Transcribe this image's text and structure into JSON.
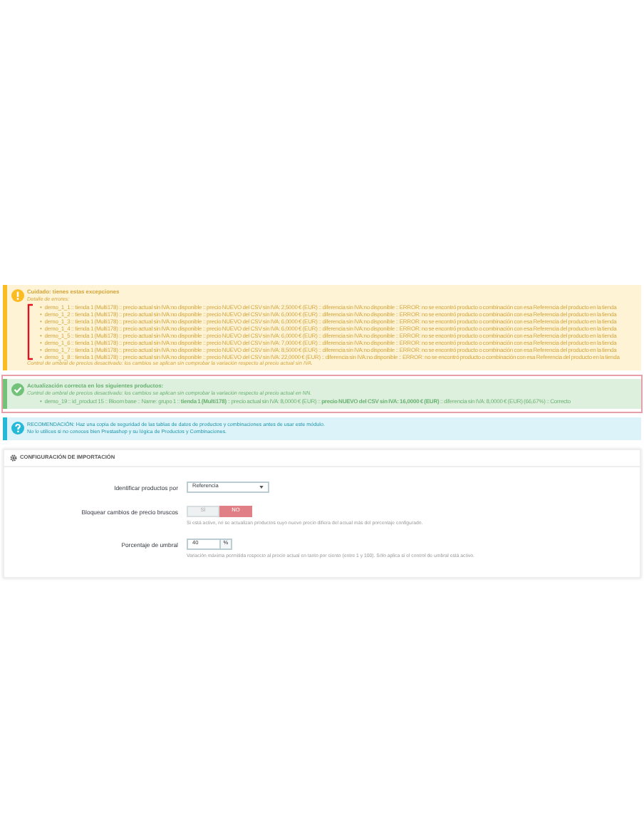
{
  "warning": {
    "title": "Cuidado: tienes estas excepciones",
    "subtitle": "Detalle de errores:",
    "bullet": "•",
    "items": [
      "demo_1_1 :: tienda 1 (Multi178) :: precio actual sin IVA:no disponible :: precio NUEVO del CSV sin IVA: 2,5000 € (EUR) :: diferencia sin IVA:no disponible :: ERROR: no se encontró producto o combinación con esa Referencia del producto en la tienda",
      "demo_1_2 :: tienda 1 (Multi178) :: precio actual sin IVA:no disponible :: precio NUEVO del CSV sin IVA: 6,0000 € (EUR) :: diferencia sin IVA:no disponible :: ERROR: no se encontró producto o combinación con esa Referencia del producto en la tienda",
      "demo_1_3 :: tienda 1 (Multi178) :: precio actual sin IVA:no disponible :: precio NUEVO del CSV sin IVA: 6,0000 € (EUR) :: diferencia sin IVA:no disponible :: ERROR: no se encontró producto o combinación con esa Referencia del producto en la tienda",
      "demo_1_4 :: tienda 1 (Multi178) :: precio actual sin IVA:no disponible :: precio NUEVO del CSV sin IVA: 6,0000 € (EUR) :: diferencia sin IVA:no disponible :: ERROR: no se encontró producto o combinación con esa Referencia del producto en la tienda",
      "demo_1_5 :: tienda 1 (Multi178) :: precio actual sin IVA:no disponible :: precio NUEVO del CSV sin IVA: 6,0000 € (EUR) :: diferencia sin IVA:no disponible :: ERROR: no se encontró producto o combinación con esa Referencia del producto en la tienda",
      "demo_1_6 :: tienda 1 (Multi178) :: precio actual sin IVA:no disponible :: precio NUEVO del CSV sin IVA: 7,0000 € (EUR) :: diferencia sin IVA:no disponible :: ERROR: no se encontró producto o combinación con esa Referencia del producto en la tienda",
      "demo_1_7 :: tienda 1 (Multi178) :: precio actual sin IVA:no disponible :: precio NUEVO del CSV sin IVA: 8,5000 € (EUR) :: diferencia sin IVA:no disponible :: ERROR: no se encontró producto o combinación con esa Referencia del producto en la tienda",
      "demo_1_8 :: tienda 1 (Multi178) :: precio actual sin IVA:no disponible :: precio NUEVO del CSV sin IVA: 22,0000 € (EUR) :: diferencia sin IVA:no disponible :: ERROR: no se encontró producto o combinación con esa Referencia del producto en la tienda"
    ],
    "footer": "Control de umbral de precios desactivado: los cambios se aplican sin comprobar la variación respecto al precio actual sin IVA."
  },
  "success": {
    "title": "Actualización correcta en los siguientes productos:",
    "bullet": "•",
    "subtitle": "Control de umbral de precios desactivado: los cambios se aplican sin comprobar la variación respecto al precio actual en NN.",
    "items": [
      "demo_19 :: id_product 15 :: Bloom base :: Name: grupo 1 :: **tienda 1 (Multi178)** :: precio actual sin IVA: 8,0000 € (EUR) :: **precio NUEVO del CSV sin IVA: 16,0000 € (EUR)** :: diferencia sin IVA: 8,0000 € (EUR) (66,67%) :: Correcto"
    ]
  },
  "info": {
    "lines": [
      "RECOMENDACIÓN: Haz una copia de seguridad de las tablas de datos de productos y combinaciones antes de usar este módulo.",
      "No lo utilices si no conoces bien Prestashop y su lógica de Productos y Combinaciones."
    ]
  },
  "panel": {
    "title": "CONFIGURACIÓN DE IMPORTACIÓN",
    "rows": [
      {
        "kind": "select",
        "label": "Identificar productos por",
        "value": "Referencia"
      },
      {
        "kind": "toggle",
        "label": "Bloquear cambios de precio bruscos",
        "options": [
          {
            "label": "SÍ",
            "selected": false
          },
          {
            "label": "NO",
            "selected": true
          }
        ],
        "help": "Si está activo, no se actualizan productos cuyo nuevo precio difiera del actual más del porcentaje configurado."
      },
      {
        "kind": "number",
        "label": "Porcentaje de umbral",
        "value": "40",
        "unit": "%",
        "help": "Variación máxima permitida respecto al precio actual en tanto por ciento (entre 1 y 100). Sólo aplica si el control de umbral está activo."
      }
    ]
  }
}
